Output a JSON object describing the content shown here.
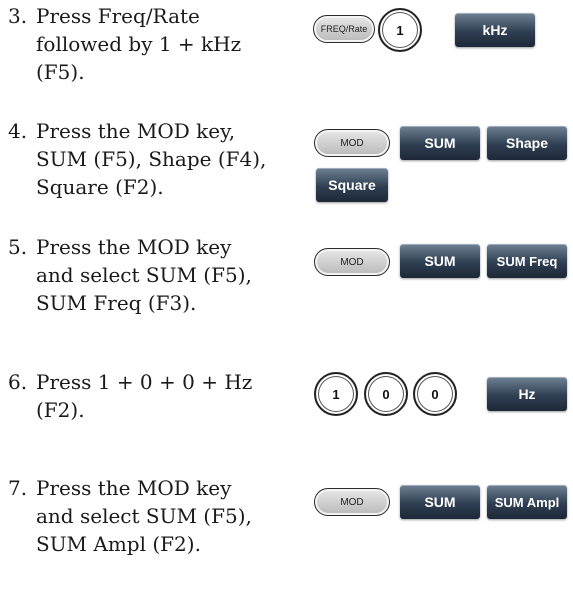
{
  "steps": [
    {
      "num": "3.",
      "lines": [
        "Press Freq/Rate",
        "followed by 1 + kHz",
        "(F5)."
      ]
    },
    {
      "num": "4.",
      "lines": [
        "Press the MOD key,",
        "SUM (F5), Shape (F4),",
        "Square (F2)."
      ]
    },
    {
      "num": "5.",
      "lines": [
        "Press the MOD key",
        "and select SUM (F5),",
        "SUM Freq (F3)."
      ]
    },
    {
      "num": "6.",
      "lines": [
        "Press 1 + 0 + 0 + Hz",
        "(F2)."
      ]
    },
    {
      "num": "7.",
      "lines": [
        "Press the MOD key",
        "and select SUM (F5),",
        "SUM Ampl (F2)."
      ]
    }
  ],
  "keys": {
    "freq_rate": "FREQ/Rate",
    "one": "1",
    "zero": "0",
    "mod": "MOD"
  },
  "softkeys": {
    "khz": "kHz",
    "sum": "SUM",
    "shape": "Shape",
    "square": "Square",
    "sum_freq": "SUM Freq",
    "hz": "Hz",
    "sum_ampl": "SUM Ampl"
  },
  "colors": {
    "softkey_dark": "#2f3f52",
    "hardkey_gray": "#c4c4c4"
  }
}
